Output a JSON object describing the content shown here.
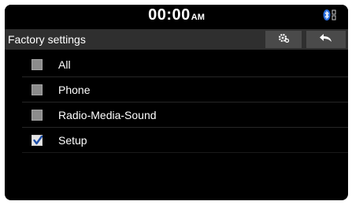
{
  "status_bar": {
    "time": "00:00",
    "ampm": "AM",
    "icons": [
      "bluetooth-icon"
    ]
  },
  "header": {
    "title": "Factory settings",
    "buttons": [
      {
        "name": "settings-gear-icon"
      },
      {
        "name": "back-arrow-icon"
      }
    ]
  },
  "list": {
    "items": [
      {
        "label": "All",
        "checked": false
      },
      {
        "label": "Phone",
        "checked": false
      },
      {
        "label": "Radio-Media-Sound",
        "checked": false
      },
      {
        "label": "Setup",
        "checked": true
      }
    ]
  },
  "colors": {
    "background": "#000000",
    "title_bar": "#2f2f2f",
    "button": "#4a4a4a",
    "check_accent": "#1f4fa8"
  }
}
